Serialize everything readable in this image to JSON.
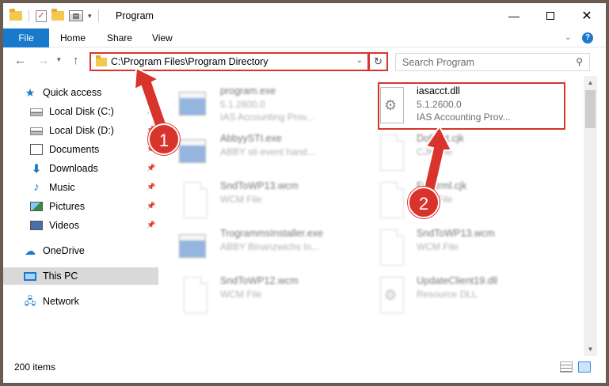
{
  "window": {
    "title": "Program",
    "controls": {
      "minimize": "—",
      "maximize": "",
      "close": "✕"
    }
  },
  "ribbon": {
    "tabs": [
      {
        "label": "File"
      },
      {
        "label": "Home"
      },
      {
        "label": "Share"
      },
      {
        "label": "View"
      }
    ],
    "help": "?"
  },
  "nav": {
    "back": "←",
    "forward": "→",
    "recent": "▾",
    "up": "↑",
    "address": "C:\\Program Files\\Program Directory",
    "address_dropdown": "⌄",
    "refresh": "↻",
    "search_placeholder": "Search Program",
    "search_icon": "⚲"
  },
  "sidebar": {
    "items": [
      {
        "label": "Quick access",
        "icon": "star-icon"
      },
      {
        "label": "Local Disk (C:)",
        "icon": "disk-icon",
        "pinned": true
      },
      {
        "label": "Local Disk (D:)",
        "icon": "disk-icon",
        "pinned": true
      },
      {
        "label": "Documents",
        "icon": "documents-icon",
        "pinned": true
      },
      {
        "label": "Downloads",
        "icon": "downloads-icon",
        "pinned": true
      },
      {
        "label": "Music",
        "icon": "music-icon",
        "pinned": true
      },
      {
        "label": "Pictures",
        "icon": "pictures-icon",
        "pinned": true
      },
      {
        "label": "Videos",
        "icon": "videos-icon",
        "pinned": true
      },
      {
        "label": "OneDrive",
        "icon": "onedrive-icon"
      },
      {
        "label": "This PC",
        "icon": "this-pc-icon",
        "selected": true
      },
      {
        "label": "Network",
        "icon": "network-icon"
      }
    ]
  },
  "files": [
    {
      "name": "program.exe",
      "line1": "5.1.2600.0",
      "line2": "IAS Accounting Prov...",
      "icon": "exe-icon",
      "blurred": true
    },
    {
      "name": "iasacct.dll",
      "line1": "5.1.2600.0",
      "line2": "IAS Accounting Prov...",
      "icon": "dll-gear-icon",
      "blurred": false
    },
    {
      "name": "AbbyySTI.exe",
      "line1": "ABBY sti event hand...",
      "line2": "",
      "icon": "exe-icon",
      "blurred": true
    },
    {
      "name": "DoFont.cjk",
      "line1": "CJK File",
      "line2": "",
      "icon": "page-icon",
      "blurred": true
    },
    {
      "name": "SndToWP13.wcm",
      "line1": "WCM File",
      "line2": "",
      "icon": "page-icon",
      "blurred": true
    },
    {
      "name": "FntNrml.cjk",
      "line1": "CJK File",
      "line2": "",
      "icon": "page-icon",
      "blurred": true
    },
    {
      "name": "TrogrammsInstaller.exe",
      "line1": "ABBY Binanzwichs In...",
      "line2": "",
      "icon": "exe-icon",
      "blurred": true
    },
    {
      "name": "SndToWP13.wcm",
      "line1": "WCM File",
      "line2": "",
      "icon": "page-icon",
      "blurred": true
    },
    {
      "name": "SndToWP12.wcm",
      "line1": "WCM File",
      "line2": "",
      "icon": "page-icon",
      "blurred": true
    },
    {
      "name": "UpdateClient19.dll",
      "line1": "Resource DLL",
      "line2": "",
      "icon": "dll-gear-icon",
      "blurred": true
    }
  ],
  "status": {
    "count": "200 items"
  },
  "callouts": {
    "one": "1",
    "two": "2"
  },
  "colors": {
    "accent": "#1979ca",
    "callout": "#d9342b",
    "folder": "#f4c84c"
  }
}
